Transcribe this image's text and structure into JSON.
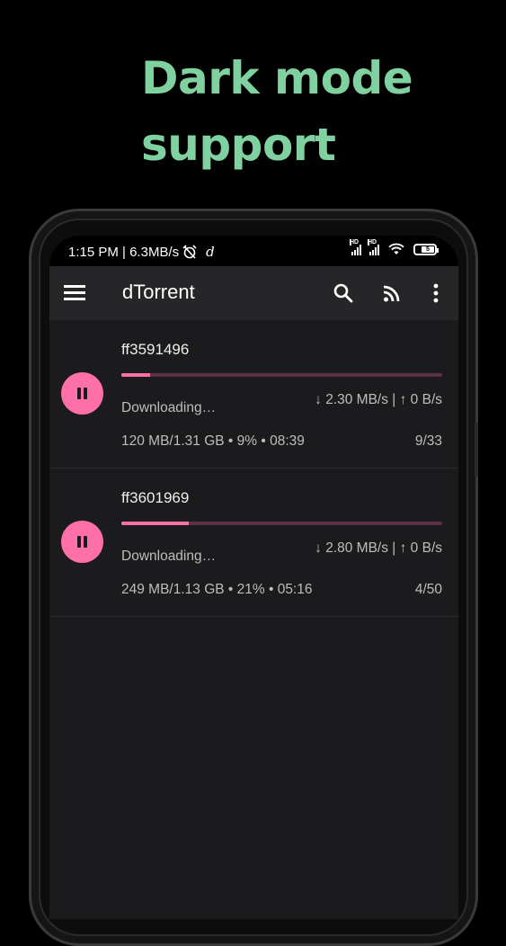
{
  "headline": {
    "line1": "Dark mode",
    "line2": "support"
  },
  "status_bar": {
    "time_speed": "1:15 PM | 6.3MB/s",
    "battery_level": "5"
  },
  "app_bar": {
    "title": "dTorrent",
    "icons": [
      "menu-icon",
      "search-icon",
      "rss-feed-icon",
      "more-vert-icon"
    ]
  },
  "torrents": [
    {
      "name": "ff3591496",
      "progress": 0.09,
      "status": "Downloading…",
      "speed": "↓ 2.30 MB/s | ↑ 0 B/s",
      "info": "120 MB/1.31 GB • 9% • 08:39",
      "pieces": "9/33"
    },
    {
      "name": "ff3601969",
      "progress": 0.21,
      "status": "Downloading…",
      "speed": "↓ 2.80 MB/s | ↑ 0 B/s",
      "info": "249 MB/1.13 GB • 21% • 05:16",
      "pieces": "4/50"
    }
  ],
  "colors": {
    "accent": "#ff6fa8",
    "headline": "#7fd1a0",
    "background": "#1b1b1d",
    "appbar": "#262628"
  }
}
